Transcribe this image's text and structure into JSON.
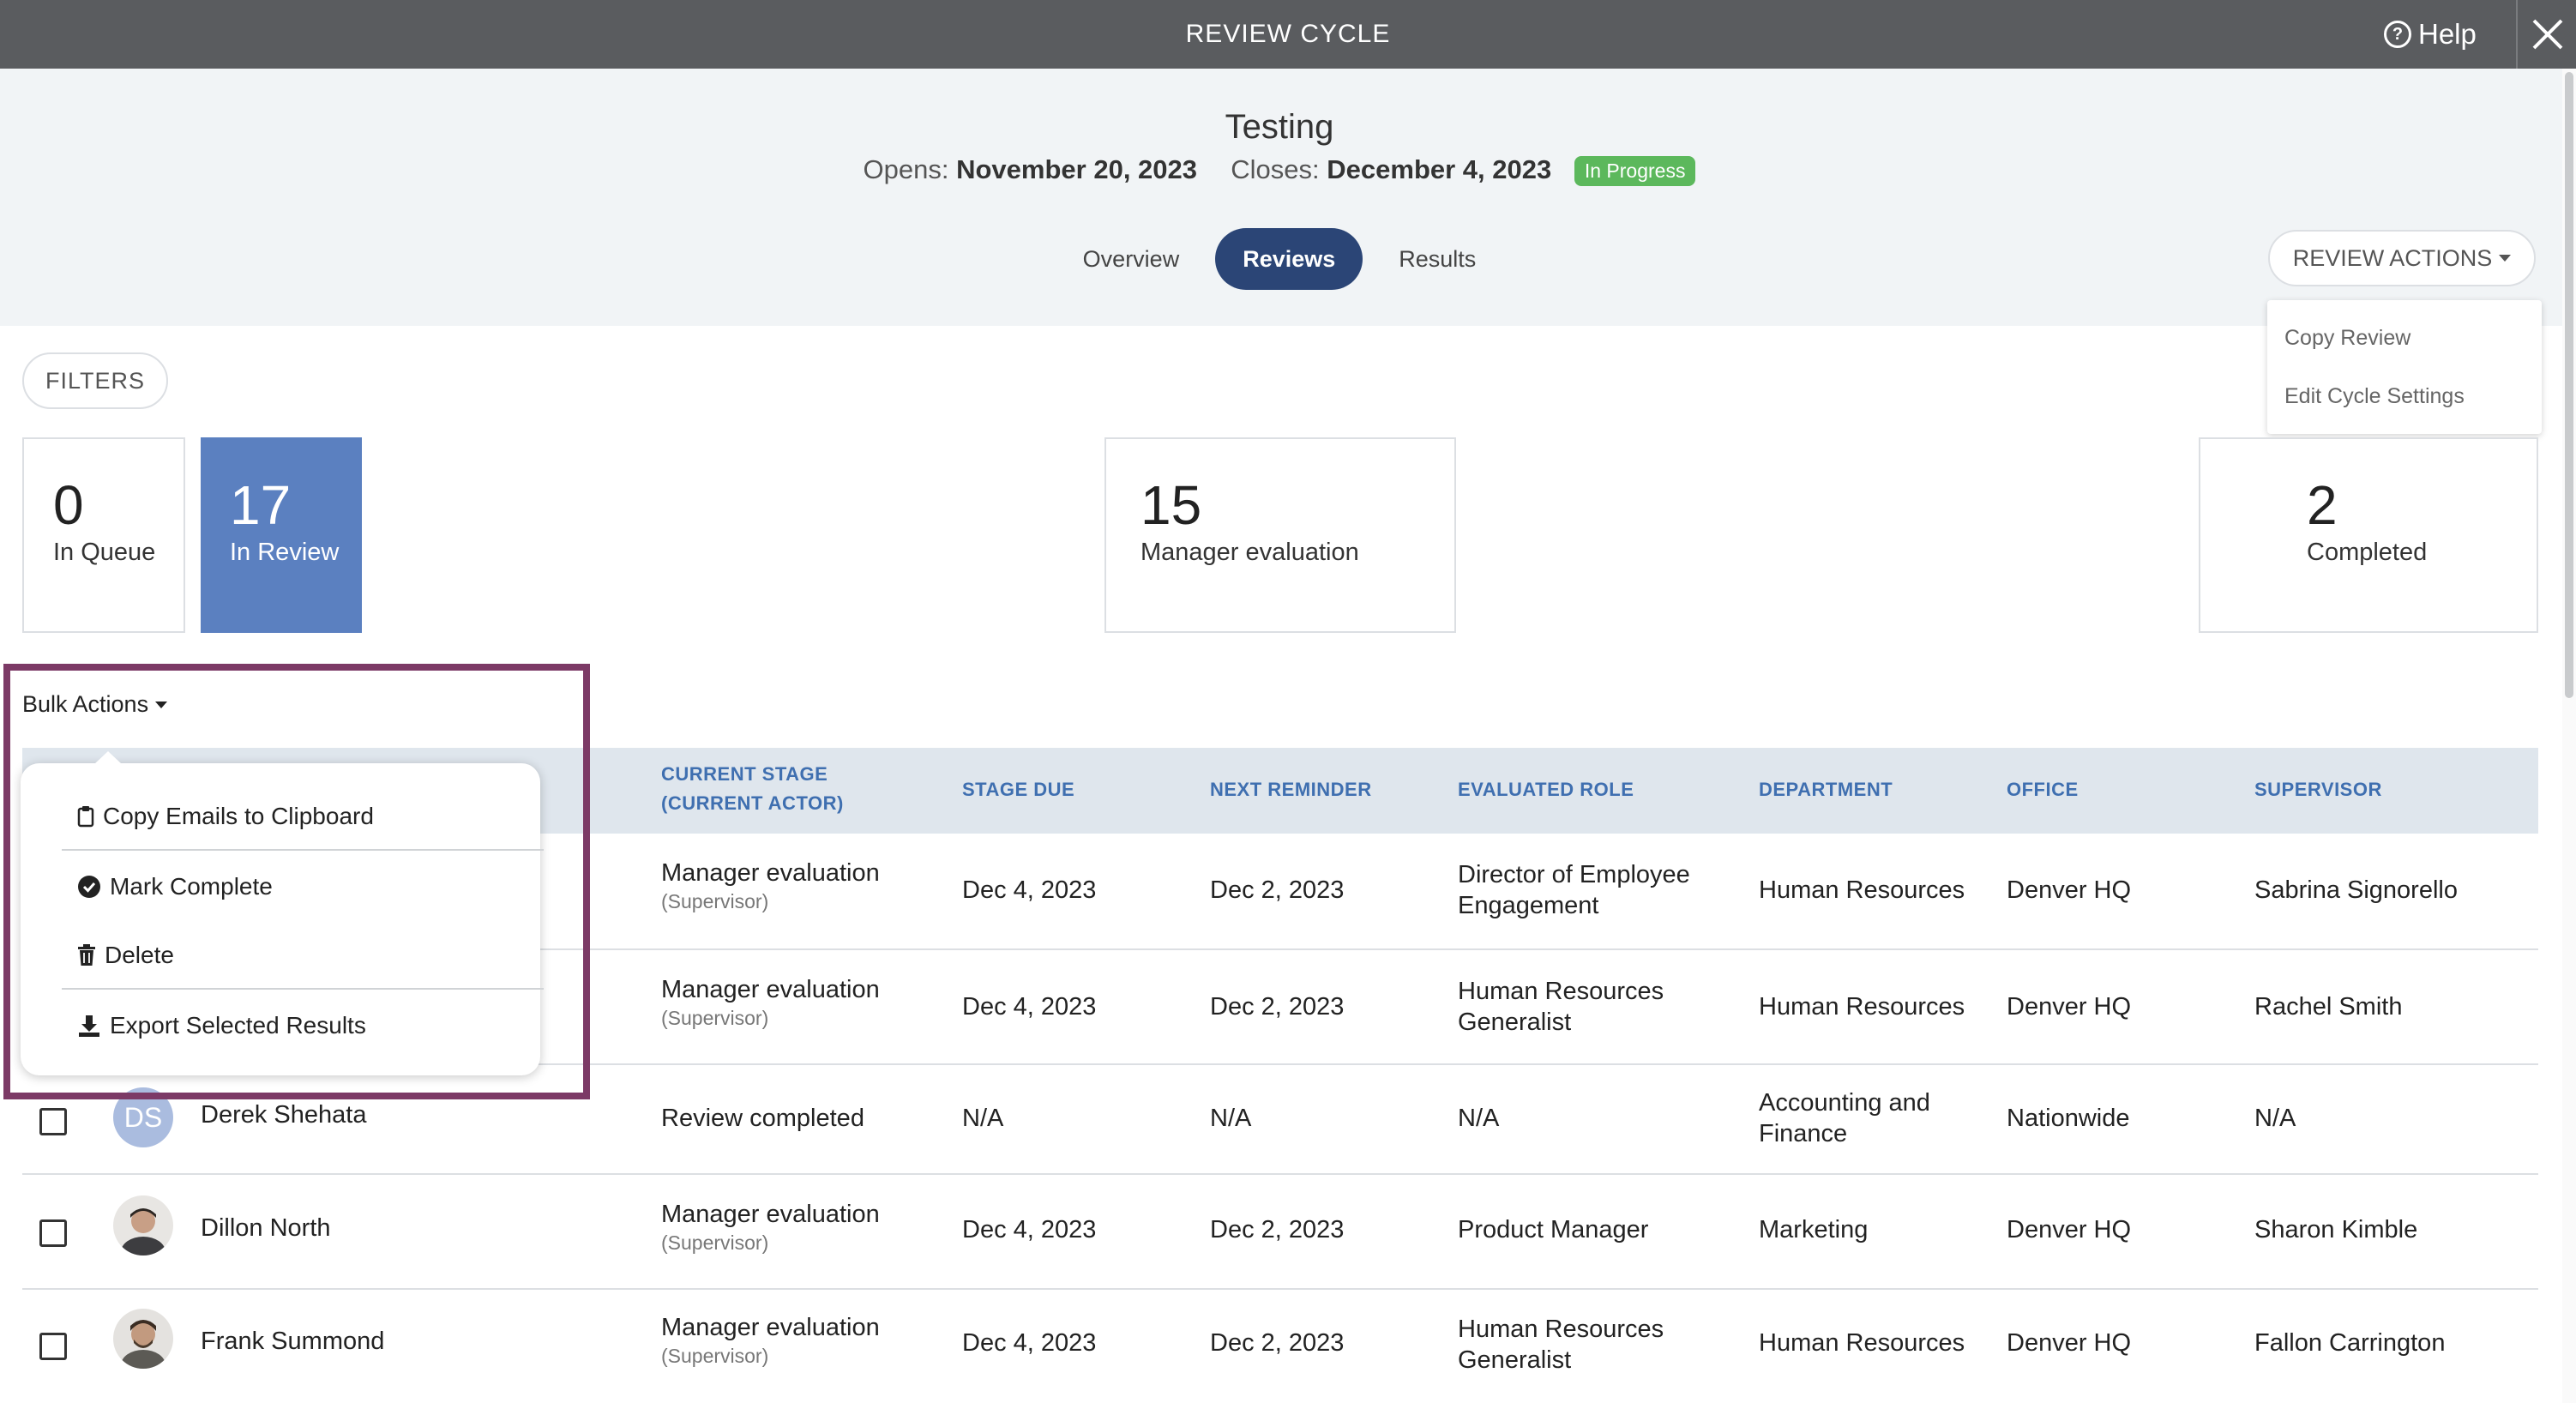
{
  "header": {
    "title": "REVIEW CYCLE",
    "help_label": "Help"
  },
  "cycle": {
    "name": "Testing",
    "opens_label": "Opens:",
    "opens_date": "November 20, 2023",
    "closes_label": "Closes:",
    "closes_date": "December 4, 2023",
    "status": "In Progress"
  },
  "tabs": [
    {
      "label": "Overview",
      "active": false
    },
    {
      "label": "Reviews",
      "active": true
    },
    {
      "label": "Results",
      "active": false
    }
  ],
  "review_actions": {
    "label": "REVIEW ACTIONS",
    "menu": [
      "Copy Review",
      "Edit Cycle Settings"
    ]
  },
  "filters_label": "FILTERS",
  "stats": [
    {
      "value": "0",
      "label": "In Queue"
    },
    {
      "value": "17",
      "label": "In Review",
      "active": true
    },
    {
      "value": "15",
      "label": "Manager evaluation"
    },
    {
      "value": "2",
      "label": "Completed"
    }
  ],
  "bulk": {
    "label": "Bulk Actions",
    "menu": [
      "Copy Emails to Clipboard",
      "Mark Complete",
      "Delete",
      "Export Selected Results"
    ]
  },
  "table": {
    "headers": {
      "stage_line1": "CURRENT STAGE",
      "stage_line2": "(CURRENT ACTOR)",
      "stage_due": "STAGE DUE",
      "next_reminder": "NEXT REMINDER",
      "evaluated_role": "EVALUATED ROLE",
      "department": "DEPARTMENT",
      "office": "OFFICE",
      "supervisor": "SUPERVISOR"
    },
    "rows": [
      {
        "name": "",
        "stage": "Manager evaluation",
        "actor": "(Supervisor)",
        "due": "Dec 4, 2023",
        "reminder": "Dec 2, 2023",
        "role_1": "Director of Employee",
        "role_2": "Engagement",
        "dept_1": "Human Resources",
        "dept_2": "",
        "office": "Denver HQ",
        "supervisor": "Sabrina Signorello"
      },
      {
        "name": "",
        "stage": "Manager evaluation",
        "actor": "(Supervisor)",
        "due": "Dec 4, 2023",
        "reminder": "Dec 2, 2023",
        "role_1": "Human Resources",
        "role_2": "Generalist",
        "dept_1": "Human Resources",
        "dept_2": "",
        "office": "Denver HQ",
        "supervisor": "Rachel Smith"
      },
      {
        "name": "Derek Shehata",
        "initials": "DS",
        "stage": "Review completed",
        "actor": "",
        "due": "N/A",
        "reminder": "N/A",
        "role_1": "N/A",
        "role_2": "",
        "dept_1": "Accounting and",
        "dept_2": "Finance",
        "office": "Nationwide",
        "supervisor": "N/A"
      },
      {
        "name": "Dillon North",
        "stage": "Manager evaluation",
        "actor": "(Supervisor)",
        "due": "Dec 4, 2023",
        "reminder": "Dec 2, 2023",
        "role_1": "Product Manager",
        "role_2": "",
        "dept_1": "Marketing",
        "dept_2": "",
        "office": "Denver HQ",
        "supervisor": "Sharon Kimble"
      },
      {
        "name": "Frank Summond",
        "stage": "Manager evaluation",
        "actor": "(Supervisor)",
        "due": "Dec 4, 2023",
        "reminder": "Dec 2, 2023",
        "role_1": "Human Resources",
        "role_2": "Generalist",
        "dept_1": "Human Resources",
        "dept_2": "",
        "office": "Denver HQ",
        "supervisor": "Fallon Carrington"
      }
    ]
  }
}
